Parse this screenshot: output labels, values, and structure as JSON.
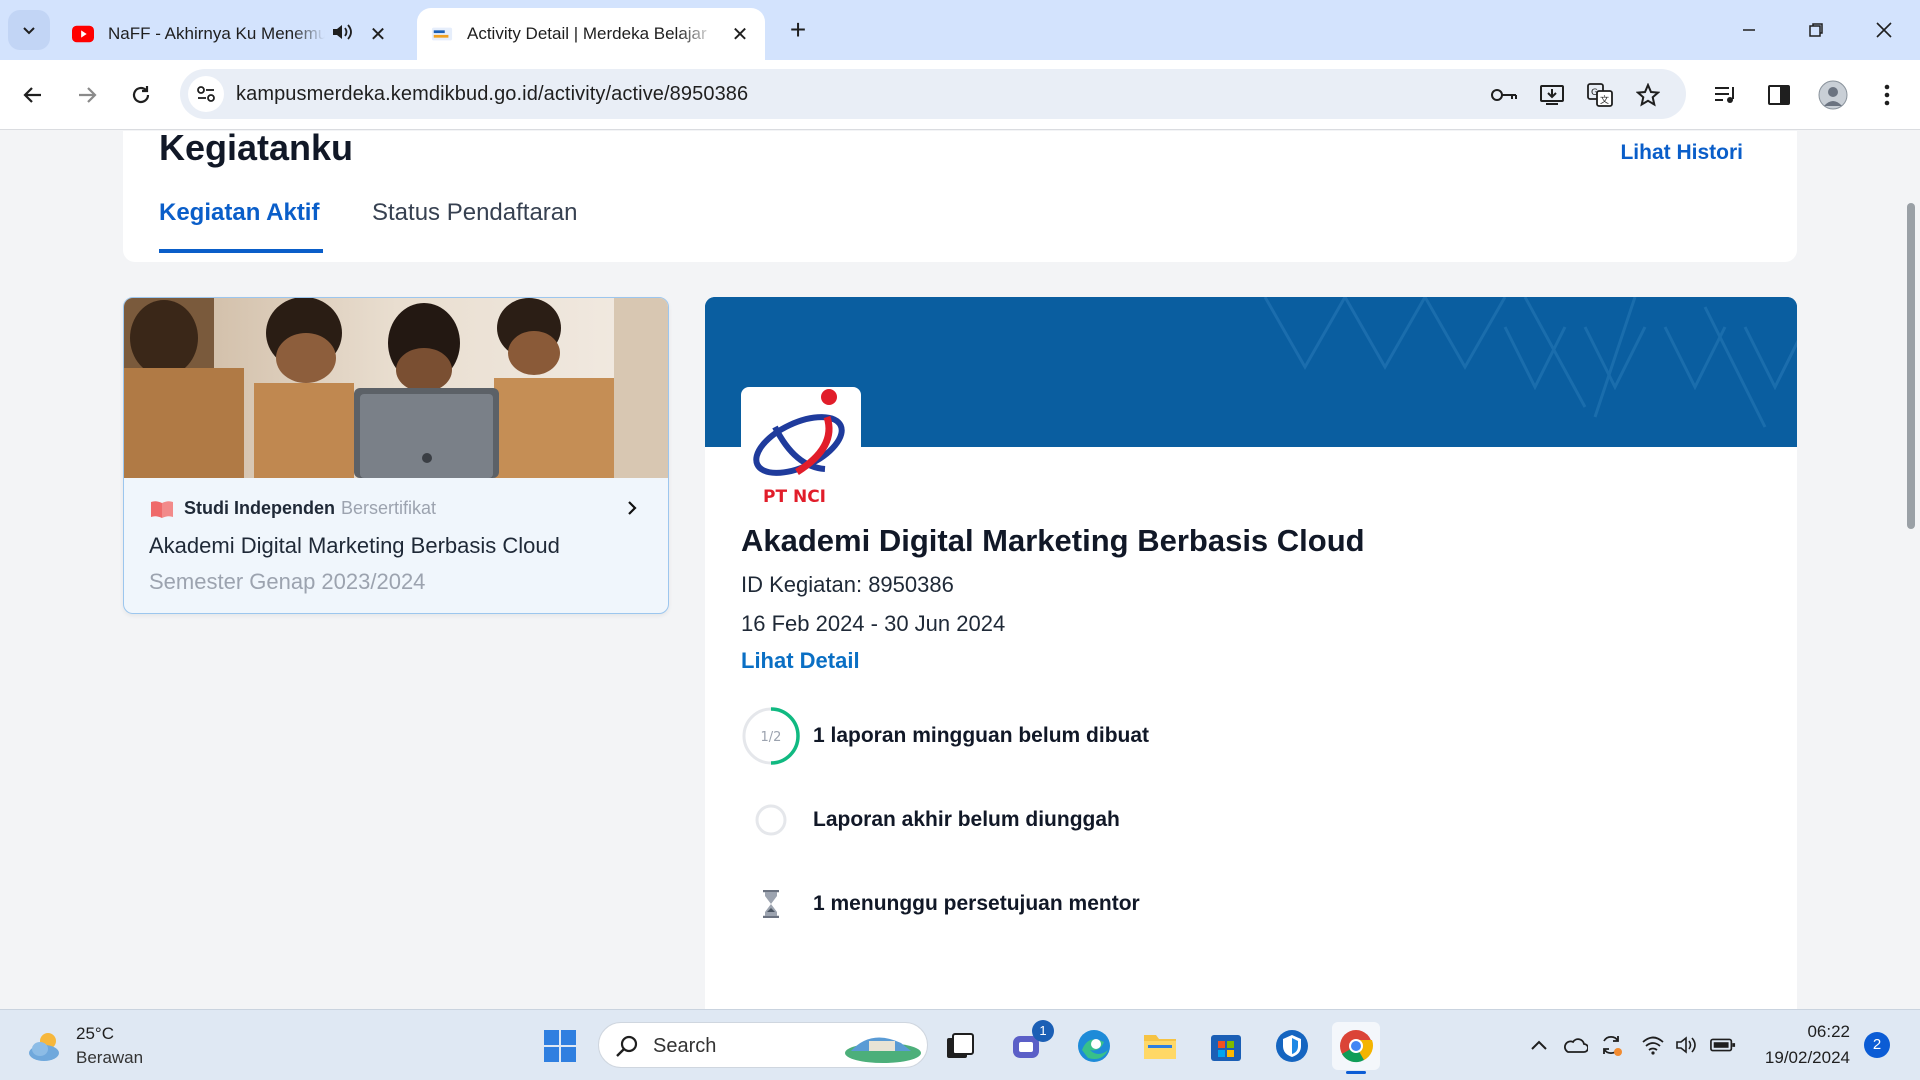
{
  "browser": {
    "tabs": [
      {
        "title": "NaFF - Akhirnya Ku Menemukanmu",
        "favicon": "youtube-icon",
        "audio": true
      },
      {
        "title": "Activity Detail | Merdeka Belajar",
        "favicon": "kampus-merdeka-icon"
      }
    ],
    "url": "kampusmerdeka.kemdikbud.go.id/activity/active/8950386"
  },
  "page": {
    "title": "Kegiatanku",
    "history_link": "Lihat Histori",
    "tabs": [
      "Kegiatan Aktif",
      "Status Pendaftaran"
    ]
  },
  "activity_card": {
    "type": "Studi Independen",
    "certificate": "Bersertifikat",
    "name": "Akademi Digital Marketing Berbasis Cloud",
    "semester": "Semester Genap 2023/2024"
  },
  "detail": {
    "logo_text": "PT  NCI",
    "title": "Akademi Digital Marketing Berbasis Cloud",
    "activity_id": "ID Kegiatan: 8950386",
    "dates": "16 Feb 2024 - 30 Jun 2024",
    "detail_link": "Lihat Detail",
    "tasks": [
      {
        "progress": "1/2",
        "text": "1 laporan mingguan belum dibuat"
      },
      {
        "text": "Laporan akhir belum diunggah"
      },
      {
        "text": "1 menunggu persetujuan mentor"
      }
    ]
  },
  "taskbar": {
    "temperature": "25°C",
    "condition": "Berawan",
    "search_label": "Search",
    "teams_badge": "1",
    "time": "06:22",
    "date": "19/02/2024",
    "notifications": "2"
  },
  "colors": {
    "accent": "#0a5ec9",
    "banner": "#0a5ea0",
    "logo_red": "#e11d2a",
    "progress": "#10b981"
  }
}
